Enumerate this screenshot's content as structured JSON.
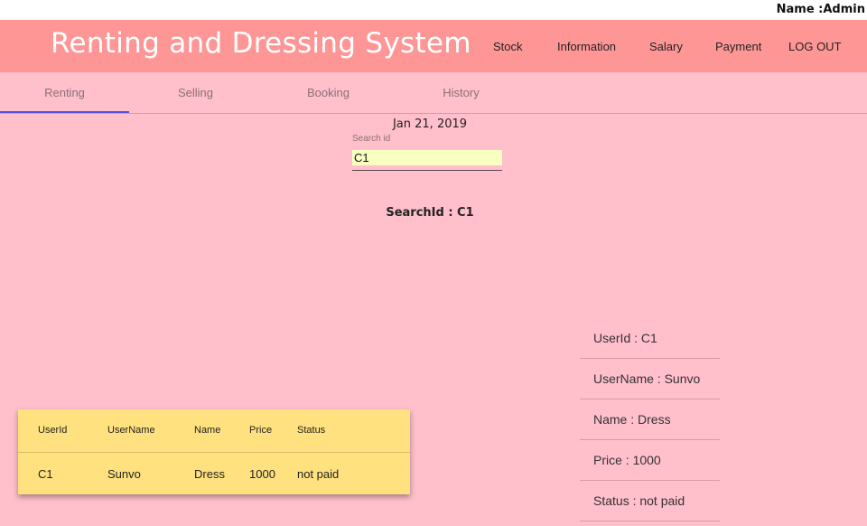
{
  "top_bar": {
    "user_name": "Name :Admin"
  },
  "header": {
    "title": "Renting and Dressing System",
    "nav": [
      "Stock",
      "Information",
      "Salary",
      "Payment",
      "LOG OUT"
    ]
  },
  "tabs": [
    {
      "label": "Renting",
      "active": true
    },
    {
      "label": "Selling",
      "active": false
    },
    {
      "label": "Booking",
      "active": false
    },
    {
      "label": "History",
      "active": false
    }
  ],
  "date": "Jan 21, 2019",
  "search": {
    "label": "Search id",
    "value": "C1",
    "result": "SearchId : C1"
  },
  "details": [
    "UserId : C1",
    "UserName : Sunvo",
    "Name : Dress",
    "Price : 1000",
    "Status : not paid"
  ],
  "table": {
    "headers": [
      "UserId",
      "UserName",
      "Name",
      "Price",
      "Status"
    ],
    "rows": [
      [
        "C1",
        "Sunvo",
        "Dress",
        "1000",
        "not paid"
      ]
    ]
  },
  "colors": {
    "header_bg": "#ff9696",
    "page_bg": "#ffbfcb",
    "active_tab_indicator": "#5b4fe0",
    "table_bg": "#ffe17f",
    "search_input_bg": "#f9ffc0"
  }
}
